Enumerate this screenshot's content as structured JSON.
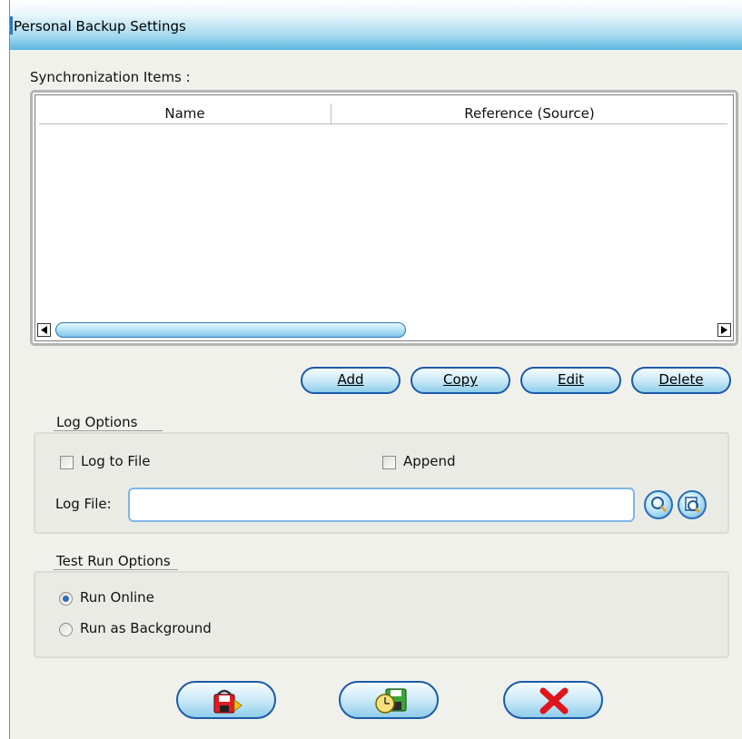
{
  "window": {
    "title": "Personal Backup Settings"
  },
  "sync": {
    "label": "Synchronization Items :",
    "columns": [
      "Name",
      "Reference (Source)"
    ],
    "rows": []
  },
  "actions": {
    "add": "Add",
    "copy": "Copy",
    "edit": "Edit",
    "delete": "Delete"
  },
  "log_options": {
    "title": "Log Options",
    "log_to_file": {
      "label": "Log to File",
      "checked": false
    },
    "append": {
      "label": "Append",
      "checked": false
    },
    "log_file_label": "Log File:",
    "log_file_value": ""
  },
  "test_run": {
    "title": "Test Run Options",
    "options": [
      {
        "label": "Run Online",
        "selected": true
      },
      {
        "label": "Run as Background",
        "selected": false
      }
    ]
  },
  "bottom_buttons": [
    {
      "icon": "backup-save-icon"
    },
    {
      "icon": "schedule-disk-icon"
    },
    {
      "icon": "cancel-x-icon"
    }
  ],
  "colors": {
    "title_gradient_end": "#5cb5df",
    "button_border": "#1d5aa7",
    "radio_dot": "#2c6dbd",
    "cancel_x": "#e0141c"
  }
}
